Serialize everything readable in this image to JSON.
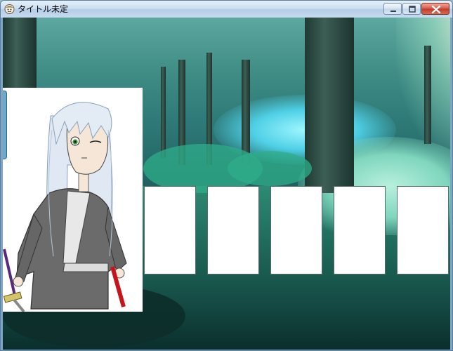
{
  "window": {
    "title": "タイトル未定",
    "controls": {
      "minimize": "minimize",
      "maximize": "maximize",
      "close": "close"
    }
  },
  "scene": {
    "background": "forest",
    "card_slots": [
      {
        "label": ""
      },
      {
        "label": ""
      },
      {
        "label": ""
      },
      {
        "label": ""
      },
      {
        "label": ""
      }
    ]
  },
  "colors": {
    "titlebar": "#c9dcef",
    "close_button": "#c33a2a",
    "forest_teal": "#2f7b79"
  }
}
